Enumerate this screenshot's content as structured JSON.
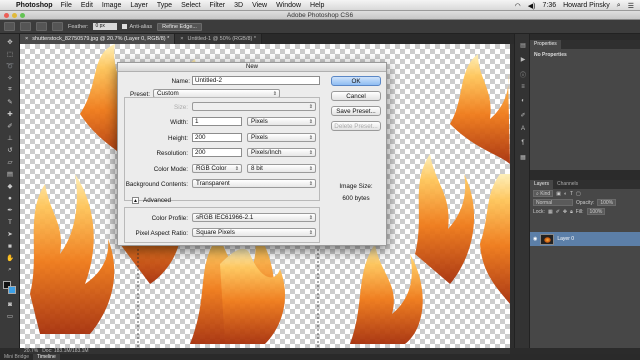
{
  "menubar": {
    "app_name": "Photoshop",
    "menus": [
      "File",
      "Edit",
      "Image",
      "Layer",
      "Type",
      "Select",
      "Filter",
      "3D",
      "View",
      "Window",
      "Help"
    ],
    "time": "7:36",
    "user": "Howard Pinsky"
  },
  "window": {
    "title": "Adobe Photoshop CS6"
  },
  "options": {
    "feather_label": "Feather:",
    "feather_value": "0 px",
    "antialias_label": "Anti-alias",
    "refine_label": "Refine Edge..."
  },
  "tabs": [
    {
      "label": "shutterstock_82750579.jpg @ 20.7% (Layer 0, RGB/8) *"
    },
    {
      "label": "Untitled-1 @ 50% (RGB/8) *"
    }
  ],
  "dialog": {
    "title": "New",
    "name_label": "Name:",
    "name_value": "Untitled-2",
    "preset_label": "Preset:",
    "preset_value": "Custom",
    "size_label": "Size:",
    "width_label": "Width:",
    "width_value": "1",
    "width_unit": "Pixels",
    "height_label": "Height:",
    "height_value": "200",
    "height_unit": "Pixels",
    "resolution_label": "Resolution:",
    "resolution_value": "200",
    "resolution_unit": "Pixels/Inch",
    "color_mode_label": "Color Mode:",
    "color_mode_value": "RGB Color",
    "bit_depth": "8 bit",
    "background_label": "Background Contents:",
    "background_value": "Transparent",
    "advanced_label": "Advanced",
    "profile_label": "Color Profile:",
    "profile_value": "sRGB IEC61966-2.1",
    "aspect_label": "Pixel Aspect Ratio:",
    "aspect_value": "Square Pixels",
    "buttons": {
      "ok": "OK",
      "cancel": "Cancel",
      "save_preset": "Save Preset...",
      "delete_preset": "Delete Preset..."
    },
    "image_size_label": "Image Size:",
    "image_size_value": "600 bytes"
  },
  "properties_panel": {
    "tab": "Properties",
    "body": "No Properties"
  },
  "layers_panel": {
    "tabs": [
      "Layers",
      "Channels"
    ],
    "kind_label": "Kind",
    "blend_mode": "Normal",
    "opacity_label": "Opacity:",
    "opacity_value": "100%",
    "lock_label": "Lock:",
    "fill_label": "Fill:",
    "fill_value": "100%",
    "layers": [
      {
        "name": "Layer 0"
      }
    ]
  },
  "status": {
    "zoom": "20.7%",
    "doc": "Doc: 183.1M/183.1M"
  },
  "bottom_tabs": [
    "Mini Bridge",
    "Timeline"
  ]
}
